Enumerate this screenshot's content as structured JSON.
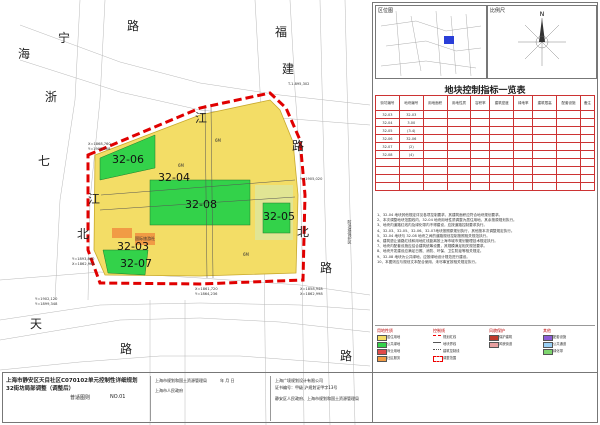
{
  "map": {
    "roads": {
      "hai": "海",
      "ning": "宁",
      "lu_top": "路",
      "zhe": "浙",
      "fu": "福",
      "jian": "建",
      "qi": "七",
      "jiang_left": "江",
      "jiang_mid": "江",
      "bei_left": "北",
      "bei_right": "北",
      "lu_right": "路",
      "tian": "天",
      "lu_bottom": "路",
      "lu_bottom_right": "路",
      "lu_mid": "路",
      "lu_right2": "路"
    },
    "coords": [
      "T-1.895,302",
      "X=1868,760",
      "Y=1905,008",
      "Y=1905,020",
      "Y=1893,800",
      "X=1862,964",
      "X=1858,948",
      "X=1862,998",
      "X=1861,720",
      "Y=1864,236",
      "Y=1902,120",
      "Y=1899,348"
    ],
    "parcels": {
      "p0406": "32-06",
      "p04": "32-04",
      "p08": "32-08",
      "p05": "32-05",
      "p03": "32-03",
      "p07": "32-07"
    },
    "green_label": "国际旅游社",
    "dimensions": [
      "6M",
      "6M",
      "6M"
    ],
    "side_label": "防洪堤保护区"
  },
  "panel": {
    "legend_title": "图例说明",
    "location_label": "区位图",
    "scale_label": "比例尺",
    "north": "N",
    "table_title": "地块控制指标一览表",
    "headers": [
      "街坊编号",
      "地块编号",
      "用地面积",
      "用地性质",
      "容积率",
      "建筑密度",
      "绿地率",
      "建筑限高",
      "配套设施",
      "备注"
    ],
    "rows": [
      [
        "32-03",
        "32-03",
        "",
        "",
        "",
        "",
        "",
        "",
        "",
        ""
      ],
      [
        "32-04",
        "3.00",
        "",
        "",
        "",
        "",
        "",
        "",
        "",
        ""
      ],
      [
        "32-05",
        "(3.4)",
        "",
        "",
        "",
        "",
        "",
        "",
        "",
        ""
      ],
      [
        "32-06",
        "32-06",
        "",
        "",
        "",
        "",
        "",
        "",
        "",
        ""
      ],
      [
        "32-07",
        "(2)",
        "",
        "",
        "",
        "",
        "",
        "",
        "",
        ""
      ],
      [
        "32-08",
        "(4)",
        "",
        "",
        "",
        "",
        "",
        "",
        "",
        ""
      ],
      [
        "",
        "",
        "",
        "",
        "",
        "",
        "",
        "",
        "",
        ""
      ],
      [
        "",
        "",
        "",
        "",
        "",
        "",
        "",
        "",
        "",
        ""
      ],
      [
        "",
        "",
        "",
        "",
        "",
        "",
        "",
        "",
        "",
        ""
      ],
      [
        "",
        "",
        "",
        "",
        "",
        "",
        "",
        "",
        "",
        ""
      ]
    ],
    "notes": [
      "1、32-04 地块其他规定详见各项控制要求，其建筑面积应符合地块规划要求。",
      "2、本次调整地块范围线内，32-04 地块用地性质调整为居住用地，其余按原规划执行。",
      "3、地块内道路红线内及绿化带内不得建设，应按道路控制要求执行。",
      "4、32-03、32-05、32-06、32-07地块按照原规划执行，其他按本次调整规定执行。",
      "5、32-04 地块与 32-08 地块之间的道路规划控制按照相关规范执行。",
      "6、建筑退让道路红线和用地红线距离按上海市城市规划管理技术规定执行。",
      "7、地块内配套设施应结合建筑统筹设置，其规模满足相关规范要求。",
      "8、地块开发建设应满足日照、消防、环保、卫生防疫等相关规定。",
      "9、32-08 地块为公共绿地，应按绿地设计规范进行建设。",
      "10、本图则应与规划文本配合使用，未尽事宜按相关规定执行。"
    ],
    "legend_groups": [
      {
        "title": "用地性质",
        "items": [
          "居住用地",
          "公共绿地",
          "商业用地",
          "社区服务"
        ]
      },
      {
        "title": "控制线",
        "items": [
          "规划红线",
          "地块界线",
          "建筑控制线",
          "调整范围"
        ]
      },
      {
        "title": "风貌保护",
        "items": [
          "保护建筑",
          "风貌街道"
        ]
      },
      {
        "title": "其他",
        "items": [
          "配套设施",
          "公共通道",
          "绿化带"
        ]
      }
    ]
  },
  "footer": {
    "title_line1": "上海市静安区天目社区C070102单元控制性详细规划",
    "title_line2": "32街坊局部调整（调整后）",
    "drawing_label": "普适图则",
    "drawing_no": "NO.01",
    "org1": "上海市规划和国土资源管理局",
    "org2": "上海广境规划设计有限公司",
    "cert": "证书编号：甲级 沪规划证甲字13号",
    "approve": "静安区人民政府、上海市规划和国土资源管理局",
    "date_label": "年 月 日",
    "reviewer": "上海市人民政府"
  },
  "colors": {
    "residential": "#f3dd66",
    "green": "#33d24a",
    "boundary": "#e00000",
    "road": "#ffffff",
    "orange": "#f19b45"
  }
}
